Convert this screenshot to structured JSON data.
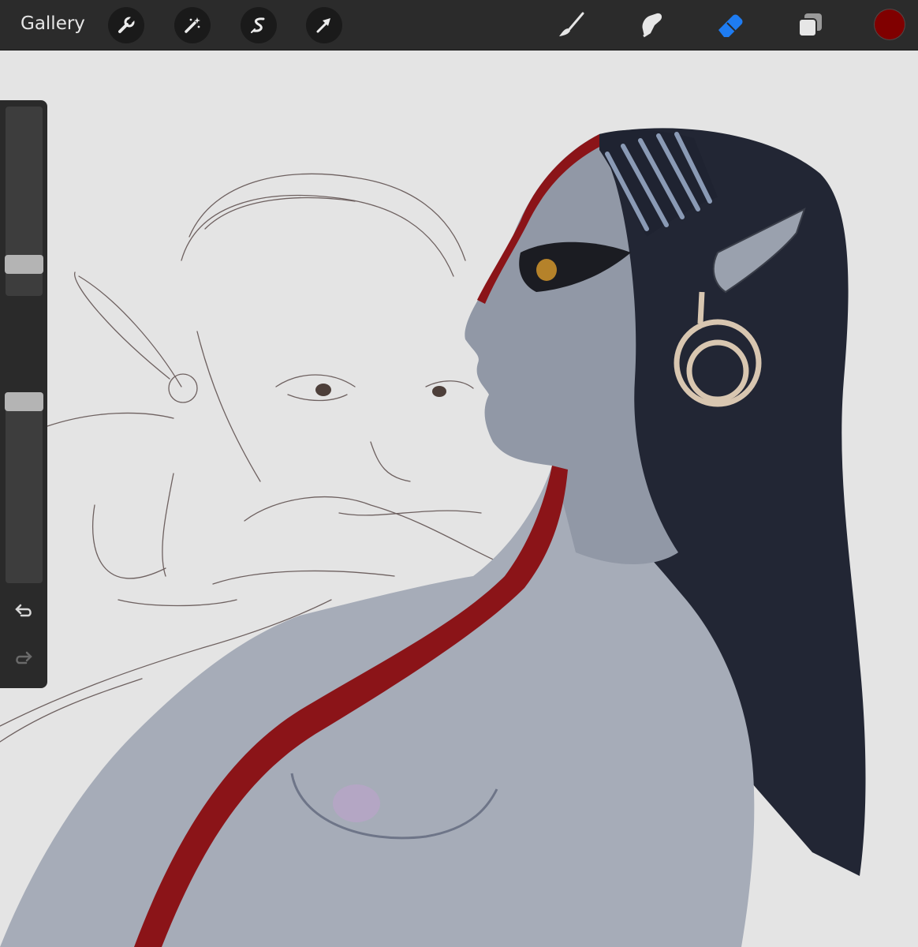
{
  "toolbar": {
    "gallery_label": "Gallery",
    "left_tools": [
      "wrench-icon",
      "magic-wand-icon",
      "selection-icon",
      "transform-arrow-icon"
    ],
    "right_tools": [
      "brush-icon",
      "smudge-icon",
      "eraser-icon",
      "layers-icon"
    ],
    "active_tool": "eraser",
    "accent_color": "#1e7cf2",
    "current_color": "#800000"
  },
  "sidebar": {
    "brush_size_slider": 0.2,
    "opacity_slider": 0.95,
    "items": [
      "brush-size-slider",
      "modify-button",
      "opacity-slider",
      "undo-button",
      "redo-button"
    ]
  },
  "canvas": {
    "background": "#e4e4e4",
    "content": "artwork"
  }
}
